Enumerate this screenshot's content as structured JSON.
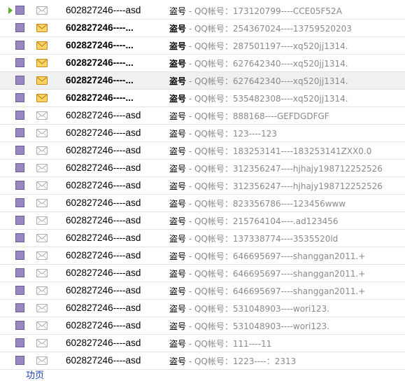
{
  "mail_list": {
    "rows": [
      {
        "sender": "602827246----asd",
        "tag": "盗号",
        "separator": " - ",
        "preview": "QQ帐号：173120799----CCE05F52A",
        "unread": false,
        "selected": true
      },
      {
        "sender": "602827246----...",
        "tag": "盗号",
        "separator": " - ",
        "preview": "QQ帐号：254367024----13759520203",
        "unread": true,
        "selected": false
      },
      {
        "sender": "602827246----...",
        "tag": "盗号",
        "separator": " - ",
        "preview": "QQ帐号：287501197----xq520jj1314.",
        "unread": true,
        "selected": false
      },
      {
        "sender": "602827246----...",
        "tag": "盗号",
        "separator": " - ",
        "preview": "QQ帐号：627642340----xq520jj1314.",
        "unread": true,
        "selected": false
      },
      {
        "sender": "602827246----...",
        "tag": "盗号",
        "separator": " - ",
        "preview": "QQ帐号：627642340----xq520jj1314.",
        "unread": true,
        "selected": false
      },
      {
        "sender": "602827246----...",
        "tag": "盗号",
        "separator": " - ",
        "preview": "QQ帐号：535482308----xq520jj1314.",
        "unread": true,
        "selected": false
      },
      {
        "sender": "602827246----asd",
        "tag": "盗号",
        "separator": " - ",
        "preview": "QQ帐号：888168----GEFDGDFGF",
        "unread": false,
        "selected": false
      },
      {
        "sender": "602827246----asd",
        "tag": "盗号",
        "separator": " - ",
        "preview": "QQ帐号：123----123",
        "unread": false,
        "selected": false
      },
      {
        "sender": "602827246----asd",
        "tag": "盗号",
        "separator": " - ",
        "preview": "QQ帐号：183253141----183253141ZXX0.0",
        "unread": false,
        "selected": false
      },
      {
        "sender": "602827246----asd",
        "tag": "盗号",
        "separator": " - ",
        "preview": "QQ帐号：312356247----hjhajy198712252526",
        "unread": false,
        "selected": false
      },
      {
        "sender": "602827246----asd",
        "tag": "盗号",
        "separator": " - ",
        "preview": "QQ帐号：312356247----hjhajy198712252526",
        "unread": false,
        "selected": false
      },
      {
        "sender": "602827246----asd",
        "tag": "盗号",
        "separator": " - ",
        "preview": "QQ帐号：823356786----123456www",
        "unread": false,
        "selected": false
      },
      {
        "sender": "602827246----asd",
        "tag": "盗号",
        "separator": " - ",
        "preview": "QQ帐号：215764104----.ad123456",
        "unread": false,
        "selected": false
      },
      {
        "sender": "602827246----asd",
        "tag": "盗号",
        "separator": " - ",
        "preview": "QQ帐号：137338774----3535520ld",
        "unread": false,
        "selected": false
      },
      {
        "sender": "602827246----asd",
        "tag": "盗号",
        "separator": " - ",
        "preview": "QQ帐号：646695697----shanggan2011.+",
        "unread": false,
        "selected": false
      },
      {
        "sender": "602827246----asd",
        "tag": "盗号",
        "separator": " - ",
        "preview": "QQ帐号：646695697----shanggan2011.+",
        "unread": false,
        "selected": false
      },
      {
        "sender": "602827246----asd",
        "tag": "盗号",
        "separator": " - ",
        "preview": "QQ帐号：646695697----shanggan2011.+",
        "unread": false,
        "selected": false
      },
      {
        "sender": "602827246----asd",
        "tag": "盗号",
        "separator": " - ",
        "preview": "QQ帐号：531048903----wori123.",
        "unread": false,
        "selected": false
      },
      {
        "sender": "602827246----asd",
        "tag": "盗号",
        "separator": " - ",
        "preview": "QQ帐号：531048903----wori123.",
        "unread": false,
        "selected": false
      },
      {
        "sender": "602827246----asd",
        "tag": "盗号",
        "separator": " - ",
        "preview": "QQ帐号：111----11",
        "unread": false,
        "selected": false
      },
      {
        "sender": "602827246----asd",
        "tag": "盗号",
        "separator": " - ",
        "preview": "QQ帐号：1223----：2313",
        "unread": false,
        "selected": false
      }
    ]
  },
  "footer": {
    "link_text": "功页"
  },
  "colors": {
    "checkbox": "#9887c0",
    "unread_envelope": "#e8a21a",
    "read_envelope": "#b8b8b8",
    "arrow": "#5bb030",
    "preview_text": "#8a8a8a"
  },
  "icons": {
    "selection_arrow": "arrow-right-icon",
    "unread": "envelope-unread-icon",
    "read": "envelope-read-icon"
  }
}
